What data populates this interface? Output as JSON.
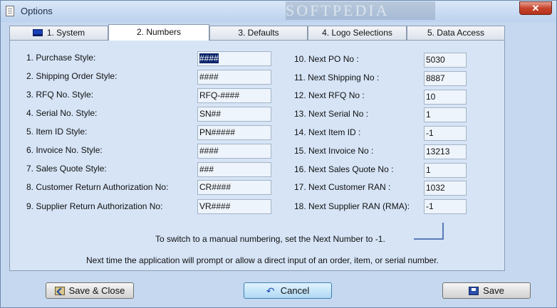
{
  "window": {
    "title": "Options",
    "close_glyph": "✕"
  },
  "tabs": [
    {
      "label": "1. System",
      "icon": "computer-icon"
    },
    {
      "label": "2. Numbers"
    },
    {
      "label": "3. Defaults"
    },
    {
      "label": "4. Logo Selections"
    },
    {
      "label": "5. Data Access"
    }
  ],
  "active_tab": "2. Numbers",
  "left_fields": [
    {
      "label": "1. Purchase Style:",
      "value": "####"
    },
    {
      "label": "2. Shipping Order Style:",
      "value": "####"
    },
    {
      "label": "3. RFQ No. Style:",
      "value": "RFQ-####"
    },
    {
      "label": "4. Serial No. Style:",
      "value": "SN##"
    },
    {
      "label": "5. Item ID Style:",
      "value": "PN#####"
    },
    {
      "label": "6. Invoice No. Style:",
      "value": "####"
    },
    {
      "label": "7. Sales Quote Style:",
      "value": "###"
    },
    {
      "label": "8. Customer Return Authorization No:",
      "value": "CR####"
    },
    {
      "label": "9. Supplier Return Authorization No:",
      "value": "VR####"
    }
  ],
  "right_fields": [
    {
      "label": "10. Next PO No :",
      "value": "5030"
    },
    {
      "label": "11. Next Shipping No :",
      "value": "8887"
    },
    {
      "label": "12. Next RFQ No :",
      "value": "10"
    },
    {
      "label": "13. Next Serial No :",
      "value": "1"
    },
    {
      "label": "14. Next Item ID :",
      "value": "-1"
    },
    {
      "label": "15. Next Invoice No :",
      "value": "13213"
    },
    {
      "label": "16. Next Sales Quote No :",
      "value": "1"
    },
    {
      "label": "17. Next Customer RAN :",
      "value": "1032"
    },
    {
      "label": "18. Next Supplier RAN (RMA):",
      "value": "-1"
    }
  ],
  "notes": {
    "line1": "To switch to a manual numbering, set the Next Number to -1.",
    "line2": "Next time the application will prompt or allow a direct input of an order, item, or serial number."
  },
  "buttons": {
    "save_close": "Save & Close",
    "cancel": "Cancel",
    "save": "Save"
  },
  "watermark": "SOFTPEDIA"
}
